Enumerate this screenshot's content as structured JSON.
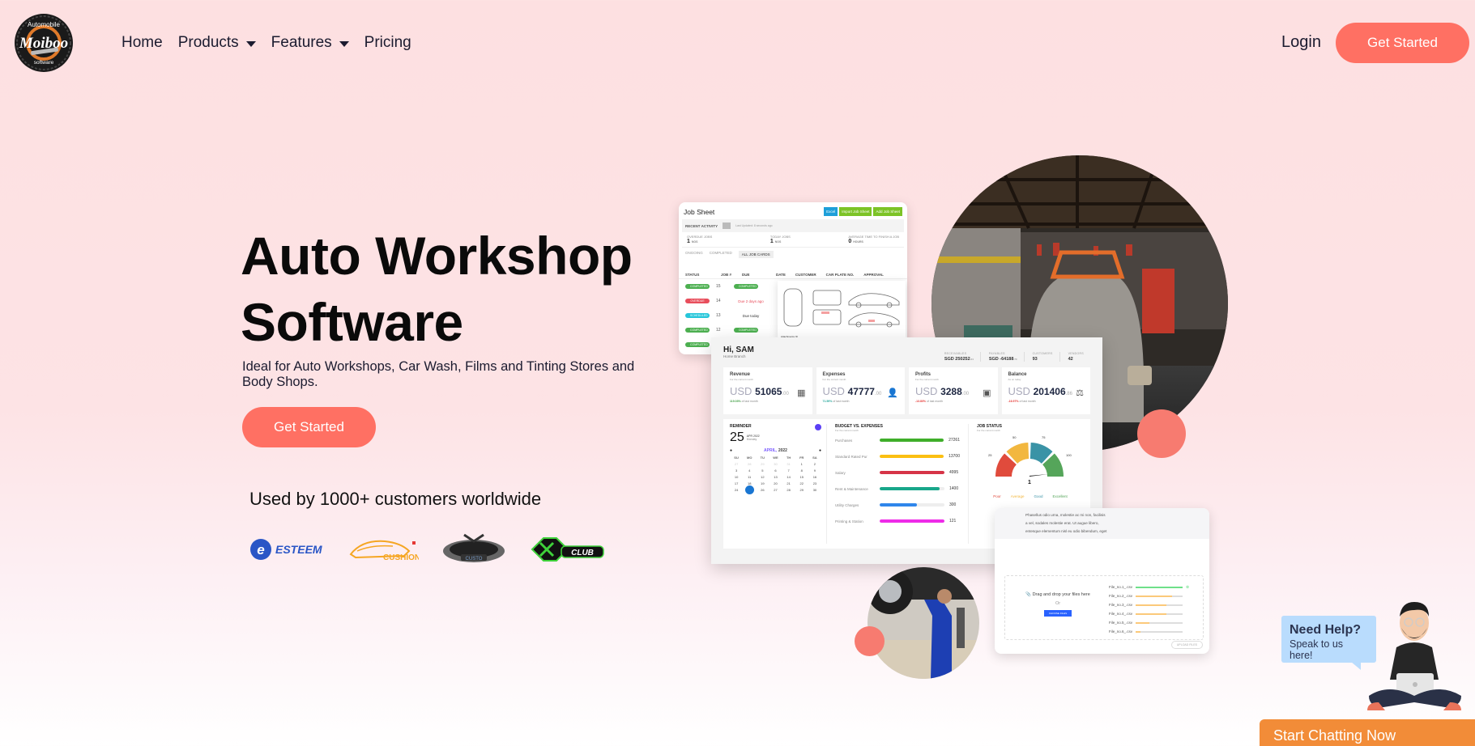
{
  "brand": {
    "logo_top_text": "Automobile",
    "logo_name": "Moiboo",
    "logo_bottom_text": "software"
  },
  "nav": {
    "items": [
      {
        "label": "Home",
        "has_dropdown": false
      },
      {
        "label": "Products",
        "has_dropdown": true
      },
      {
        "label": "Features",
        "has_dropdown": true
      },
      {
        "label": "Pricing",
        "has_dropdown": false
      }
    ],
    "login_label": "Login",
    "cta_label": "Get Started"
  },
  "hero": {
    "title_line1": "Auto Workshop",
    "title_line2": "Software",
    "subtitle": "Ideal for Auto Workshops, Car Wash, Films and Tinting Stores and Body Shops.",
    "cta_label": "Get Started",
    "used_by": "Used by 1000+ customers worldwide",
    "clients": [
      "ESTEEM",
      "Ngam Brothers Cushion",
      "Custo",
      "KC Club"
    ]
  },
  "colors": {
    "accent": "#ff7063",
    "chat": "#f28c38",
    "bubble": "#b9dcfd",
    "text": "#1b1b2f"
  },
  "job_sheet": {
    "title": "Job Sheet",
    "buttons": [
      "Excel",
      "Import Job Sheet",
      "Add Job Sheet"
    ],
    "recent_activity": "RECENT ACTIVITY",
    "last_updated": "Last Updated: 8 seconds ago",
    "stats": [
      {
        "label": "OVERDUE JOBS",
        "value": "1",
        "unit": "NOS"
      },
      {
        "label": "TODAY JOBS",
        "value": "1",
        "unit": "NOS"
      },
      {
        "label": "AVERAGE TIME TO FINISH A JOB",
        "value": "0",
        "unit": "HOURS"
      }
    ],
    "tabs": [
      "ONGOING",
      "COMPLETED",
      "ALL JOB CARDS"
    ],
    "columns": [
      "STATUS",
      "JOB #",
      "DUE",
      "DATE",
      "CUSTOMER",
      "CAR PLATE NO.",
      "APPROVAL"
    ],
    "rows": [
      {
        "status": "COMPLETED",
        "status_color": "#4caf50",
        "job": "15",
        "due": "COMPLETED",
        "due_pill": true
      },
      {
        "status": "OVERDUE",
        "status_color": "#e84e5c",
        "job": "14",
        "due": "Due 2 days ago",
        "due_pill": false
      },
      {
        "status": "SCHEDULED",
        "status_color": "#26c6da",
        "job": "13",
        "due": "Due today",
        "due_pill": false
      },
      {
        "status": "COMPLETED",
        "status_color": "#4caf50",
        "job": "12",
        "due": "COMPLETED",
        "due_pill": true
      },
      {
        "status": "COMPLETED",
        "status_color": "#4caf50",
        "job": "",
        "due": "",
        "due_pill": false
      }
    ],
    "attachments_label": "Attachments (3)"
  },
  "dashboard": {
    "greeting": "Hi, SAM",
    "branch": "Home Branch",
    "kpis": [
      {
        "label": "RECEIVABLES",
        "value": "SGD 250252",
        "decimals": ".04"
      },
      {
        "label": "PAYABLES",
        "value": "SGD -64188",
        "decimals": ".70"
      },
      {
        "label": "CUSTOMERS",
        "value": "93",
        "decimals": ""
      },
      {
        "label": "VENDORS",
        "value": "42",
        "decimals": ""
      }
    ],
    "cards": [
      {
        "title": "Revenue",
        "sub": "For the current month",
        "currency": "USD",
        "amount": "51065",
        "decimals": ".00",
        "pct": "119.03%",
        "pct_suffix": "of last month",
        "pct_color": "#43a047",
        "icon": "calendar-icon"
      },
      {
        "title": "Expenses",
        "sub": "For the current month",
        "currency": "USD",
        "amount": "47777",
        "decimals": ".00",
        "pct": "71.59%",
        "pct_suffix": "of last month",
        "pct_color": "#26a69a",
        "icon": "user-icon"
      },
      {
        "title": "Profits",
        "sub": "For the current month",
        "currency": "USD",
        "amount": "3288",
        "decimals": ".00",
        "pct": "-13.80%",
        "pct_suffix": "of last month",
        "pct_color": "#e53935",
        "icon": "money-icon"
      },
      {
        "title": "Balance",
        "sub": "As on today",
        "currency": "USD",
        "amount": "201406",
        "decimals": ".86",
        "pct": "-16.97%",
        "pct_suffix": "of last month",
        "pct_color": "#e53935",
        "icon": "scale-icon"
      }
    ],
    "reminder": {
      "title": "REMINDER",
      "day": "25",
      "month_year": "APR 2022",
      "weekday": "Monday",
      "calendar_month": "APRIL",
      "calendar_year": "2022",
      "weekdays": [
        "SU",
        "MO",
        "TU",
        "WE",
        "TH",
        "FR",
        "SA"
      ],
      "days": [
        [
          "27",
          "28",
          "29",
          "30",
          "31",
          "1",
          "2"
        ],
        [
          "3",
          "4",
          "5",
          "6",
          "7",
          "8",
          "9"
        ],
        [
          "10",
          "11",
          "12",
          "13",
          "14",
          "15",
          "16"
        ],
        [
          "17",
          "18",
          "19",
          "20",
          "21",
          "22",
          "23"
        ],
        [
          "24",
          "25",
          "26",
          "27",
          "28",
          "29",
          "30"
        ]
      ],
      "selected_day": "25"
    },
    "budget": {
      "title": "BUDGET VS. EXPENSES",
      "sub": "For the current month",
      "rows": [
        {
          "label": "Purchases",
          "value": "27261",
          "fill": 1.0,
          "color": "#3fae2a"
        },
        {
          "label": "Standard Rated Pur",
          "value": "13700",
          "fill": 1.0,
          "color": "#fbbf12"
        },
        {
          "label": "Salary",
          "value": "4995",
          "fill": 1.0,
          "color": "#d63447"
        },
        {
          "label": "Rent & Maintenance",
          "value": "1400",
          "fill": 0.92,
          "color": "#18a78a"
        },
        {
          "label": "Utility Charges",
          "value": "300",
          "fill": 0.58,
          "color": "#2f86eb"
        },
        {
          "label": "Printing & Station",
          "value": "121",
          "fill": 1.0,
          "color": "#ee2be8"
        }
      ]
    },
    "job_status": {
      "title": "JOB STATUS",
      "sub": "For the current month",
      "ticks": [
        "25",
        "50",
        "75",
        "100"
      ],
      "value": "1",
      "legend": [
        {
          "label": "Poor",
          "color": "#e04b3c"
        },
        {
          "label": "Average",
          "color": "#f2b73f"
        },
        {
          "label": "Good",
          "color": "#3a93a6"
        },
        {
          "label": "Excellent",
          "color": "#55a55a"
        }
      ]
    }
  },
  "upload_card": {
    "text_lines": [
      "Phasellus odio urna, molestie ac mi non, facilisis",
      "a vel, sodales molestie erat. Ut augue libero,",
      "entesque elementum nisl eu odio bibendum, eget"
    ],
    "drop_label": "Drag and drop your files here",
    "or_label": "Or",
    "choose_label": "CHOOSE FILES",
    "upload_label": "UPLOAD FILES",
    "files": [
      {
        "name": "File_no.1_.csv",
        "progress": 1.0,
        "done": true
      },
      {
        "name": "File_no.2_.csv",
        "progress": 0.78,
        "done": false
      },
      {
        "name": "File_no.3_.csv",
        "progress": 0.65,
        "done": false
      },
      {
        "name": "File_no.4_.csv",
        "progress": 0.65,
        "done": false
      },
      {
        "name": "File_no.5_.csv",
        "progress": 0.3,
        "done": false
      },
      {
        "name": "File_no.6_.csv",
        "progress": 0.1,
        "done": false
      }
    ]
  },
  "chat": {
    "bubble_title": "Need Help?",
    "bubble_sub": "Speak to us here!",
    "cta_label": "Start Chatting Now"
  }
}
